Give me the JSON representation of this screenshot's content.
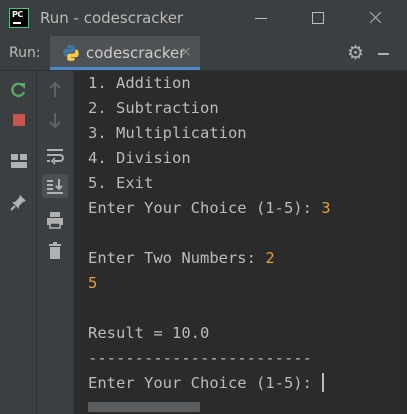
{
  "window": {
    "app_icon_text": "PC",
    "title": "Run - codescracker"
  },
  "run_panel": {
    "label": "Run:",
    "tab_label": "codescracker",
    "tab_close": "×"
  },
  "console": {
    "lines": [
      {
        "text": "1. Addition",
        "input": ""
      },
      {
        "text": "2. Subtraction",
        "input": ""
      },
      {
        "text": "3. Multiplication",
        "input": ""
      },
      {
        "text": "4. Division",
        "input": ""
      },
      {
        "text": "5. Exit",
        "input": ""
      },
      {
        "text": "Enter Your Choice (1-5): ",
        "input": "3"
      },
      {
        "text": "",
        "input": ""
      },
      {
        "text": "Enter Two Numbers: ",
        "input": "2"
      },
      {
        "text": "",
        "input": "5"
      },
      {
        "text": "",
        "input": ""
      },
      {
        "text": "Result = 10.0",
        "input": ""
      },
      {
        "text": "------------------------",
        "input": ""
      },
      {
        "text": "Enter Your Choice (1-5): ",
        "input": ""
      }
    ]
  },
  "colors": {
    "user_input": "#e0a037",
    "rerun_green": "#59a869",
    "stop_red": "#c75450",
    "tab_accent": "#4a88c7"
  },
  "icons": {
    "left_toolbar": [
      "rerun-icon",
      "stop-icon",
      "layout-icon",
      "pin-icon"
    ],
    "second_toolbar": [
      "arrow-up-icon",
      "arrow-down-icon",
      "soft-wrap-icon",
      "scroll-to-end-icon",
      "print-icon",
      "trash-icon"
    ]
  }
}
